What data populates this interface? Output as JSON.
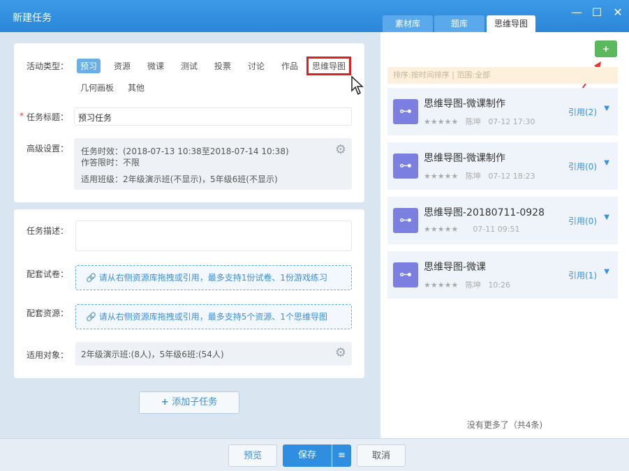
{
  "window": {
    "title": "新建任务",
    "minimize": "—",
    "maximize": "☐",
    "close": "✕"
  },
  "tabs": [
    {
      "label": "素材库"
    },
    {
      "label": "题库"
    },
    {
      "label": "思维导图"
    }
  ],
  "form": {
    "activity_label": "活动类型：",
    "types": [
      "预习",
      "资源",
      "微课",
      "测试",
      "投票",
      "讨论",
      "作品",
      "思维导图",
      "几何画板",
      "其他"
    ],
    "required_mark": "*",
    "title_label": "任务标题：",
    "title_value": "预习任务",
    "advanced_label": "高级设置：",
    "advanced": {
      "validity": "任务时效：(2018-07-13 10:38至2018-07-14 10:38)",
      "limit": "作答限时：不限",
      "classes": "适用班级：2年级演示班(不显示)，5年级6班(不显示)"
    },
    "desc_label": "任务描述：",
    "paper_label": "配套试卷：",
    "paper_hint": "请从右侧资源库拖拽或引用，最多支持1份试卷、1份游戏练习",
    "resource_label": "配套资源：",
    "resource_hint": "请从右侧资源库拖拽或引用，最多支持5个资源、1个思维导图",
    "target_label": "适用对象：",
    "target_value": "2年级演示班:(8人)，5年级6班:(54人)",
    "add_subtask": "添加子任务"
  },
  "right": {
    "add_button": "+",
    "filter": "排序:按时间排序 | 范围:全部",
    "items": [
      {
        "name": "思维导图-微课制作",
        "stars": "★★★★★",
        "author": "陈坤",
        "time": "07-12 17:30",
        "ref": "引用(2)"
      },
      {
        "name": "思维导图-微课制作",
        "stars": "★★★★★",
        "author": "陈坤",
        "time": "07-12 18:23",
        "ref": "引用(0)"
      },
      {
        "name": "思维导图-20180711-0928",
        "stars": "★★★★★",
        "author": "",
        "time": "07-11 09:51",
        "ref": "引用(0)"
      },
      {
        "name": "思维导图-微课",
        "stars": "★★★★★",
        "author": "陈坤",
        "time": "10:26",
        "ref": "引用(1)"
      }
    ],
    "footer": "没有更多了（共4条)"
  },
  "bottom": {
    "preview": "预览",
    "save": "保存",
    "menu": "≡",
    "cancel": "取消"
  }
}
